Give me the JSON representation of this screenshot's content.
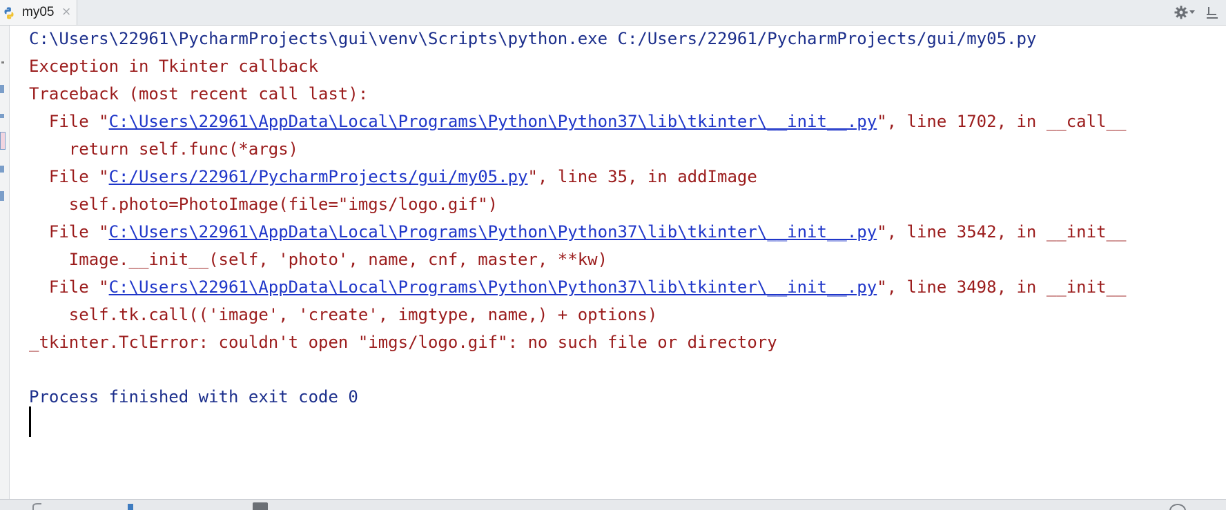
{
  "tab": {
    "label": "my05",
    "icon": "python-file-icon",
    "close_glyph": "×"
  },
  "toolbar": {
    "settings_icon": "gear-icon",
    "pin_icon": "pin-icon"
  },
  "console": {
    "command": "C:\\Users\\22961\\PycharmProjects\\gui\\venv\\Scripts\\python.exe C:/Users/22961/PycharmProjects/gui/my05.py",
    "exception_header": "Exception in Tkinter callback",
    "traceback_header": "Traceback (most recent call last):",
    "frames": [
      {
        "prefix": "  File \"",
        "path": "C:\\Users\\22961\\AppData\\Local\\Programs\\Python\\Python37\\lib\\tkinter\\__init__.py",
        "suffix": "\", line 1702, in __call__",
        "code": "    return self.func(*args)"
      },
      {
        "prefix": "  File \"",
        "path": "C:/Users/22961/PycharmProjects/gui/my05.py",
        "suffix": "\", line 35, in addImage",
        "code": "    self.photo=PhotoImage(file=\"imgs/logo.gif\")"
      },
      {
        "prefix": "  File \"",
        "path": "C:\\Users\\22961\\AppData\\Local\\Programs\\Python\\Python37\\lib\\tkinter\\__init__.py",
        "suffix": "\", line 3542, in __init__",
        "code": "    Image.__init__(self, 'photo', name, cnf, master, **kw)"
      },
      {
        "prefix": "  File \"",
        "path": "C:\\Users\\22961\\AppData\\Local\\Programs\\Python\\Python37\\lib\\tkinter\\__init__.py",
        "suffix": "\", line 3498, in __init__",
        "code": "    self.tk.call(('image', 'create', imgtype, name,) + options)"
      }
    ],
    "error": "_tkinter.TclError: couldn't open \"imgs/logo.gif\": no such file or directory",
    "exit_message": "Process finished with exit code 0"
  },
  "colors": {
    "command": "#1c2f8c",
    "error": "#9b1c1c",
    "link": "#1f36c9"
  }
}
